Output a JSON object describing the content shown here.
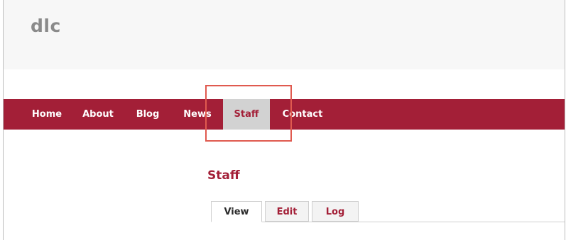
{
  "site": {
    "name": "dlc"
  },
  "nav": {
    "items": [
      {
        "label": "Home"
      },
      {
        "label": "About"
      },
      {
        "label": "Blog"
      },
      {
        "label": "News"
      },
      {
        "label": "Staff"
      },
      {
        "label": "Contact"
      }
    ],
    "active": "Staff"
  },
  "page": {
    "title": "Staff"
  },
  "tabs": [
    {
      "label": "View"
    },
    {
      "label": "Edit"
    },
    {
      "label": "Log"
    }
  ],
  "colors": {
    "brand": "#a31f37",
    "active_nav_bg": "#d2d2d2",
    "highlight": "#e05a4f"
  }
}
